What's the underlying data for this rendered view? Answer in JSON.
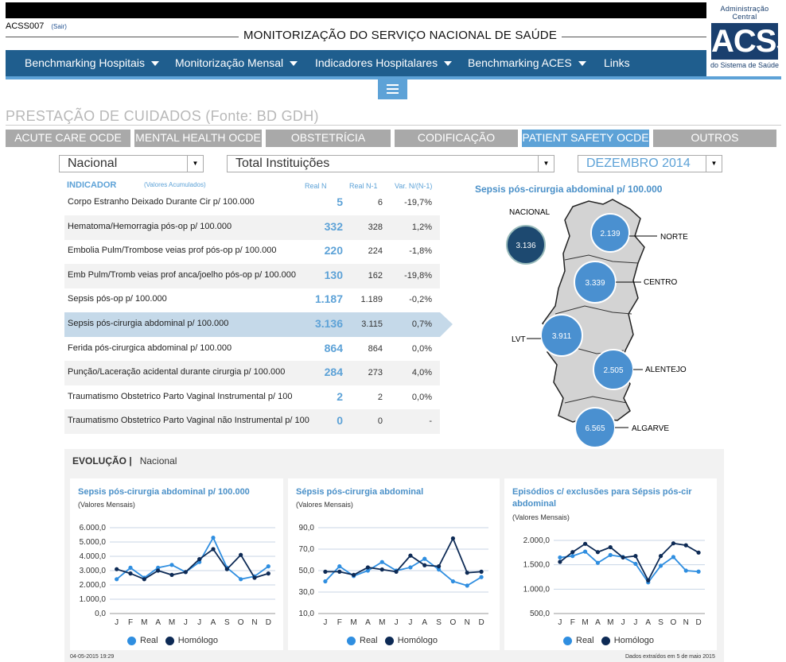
{
  "header": {
    "user_code": "ACSS007",
    "logout_label": "(Sair)",
    "app_title": "MONITORIZAÇÃO DO SERVIÇO NACIONAL DE SAÚDE",
    "logo": {
      "top": "Administração Central",
      "mark": "ACSS",
      "bottom": "do Sistema de Saúde"
    }
  },
  "nav": {
    "items": [
      {
        "label": "Benchmarking Hospitais",
        "dropdown": true
      },
      {
        "label": "Monitorização Mensal",
        "dropdown": true
      },
      {
        "label": "Indicadores Hospitalares",
        "dropdown": true
      },
      {
        "label": "Benchmarking ACES",
        "dropdown": true
      },
      {
        "label": "Links",
        "dropdown": false
      }
    ],
    "menu_icon": "hamburger-icon"
  },
  "section": {
    "title": "PRESTAÇÃO DE CUIDADOS (Fonte: BD GDH)",
    "tabs": [
      "ACUTE CARE OCDE",
      "MENTAL HEALTH OCDE",
      "OBSTETRÍCIA",
      "CODIFICAÇÃO",
      "PATIENT SAFETY OCDE",
      "OUTROS"
    ],
    "active_tab": "PATIENT SAFETY OCDE"
  },
  "filters": {
    "region": "Nacional",
    "institution": "Total Instituições",
    "period": "DEZEMBRO 2014"
  },
  "table": {
    "header": {
      "indicator": "INDICADOR",
      "note": "(Valores Acumulados)",
      "real_n": "Real N",
      "real_n1": "Real N-1",
      "var": "Var. N/(N-1)"
    },
    "rows": [
      {
        "name": "Corpo Estranho Deixado Durante Cir p/ 100.000",
        "real_n": "5",
        "real_n1": "6",
        "var": "-19,7%"
      },
      {
        "name": "Hematoma/Hemorragia pós-op p/ 100.000",
        "real_n": "332",
        "real_n1": "328",
        "var": "1,2%"
      },
      {
        "name": "Embolia Pulm/Trombose veias prof pós-op p/ 100.000",
        "real_n": "220",
        "real_n1": "224",
        "var": "-1,8%"
      },
      {
        "name": "Emb Pulm/Tromb veias prof anca/joelho pós-op p/ 100.000",
        "real_n": "130",
        "real_n1": "162",
        "var": "-19,8%"
      },
      {
        "name": "Sepsis pós-op p/ 100.000",
        "real_n": "1.187",
        "real_n1": "1.189",
        "var": "-0,2%"
      },
      {
        "name": "Sepsis pós-cirurgia abdominal p/ 100.000",
        "real_n": "3.136",
        "real_n1": "3.115",
        "var": "0,7%"
      },
      {
        "name": "Ferida pós-cirurgica abdominal p/ 100.000",
        "real_n": "864",
        "real_n1": "864",
        "var": "0,0%"
      },
      {
        "name": "Punção/Laceração acidental durante cirurgia p/ 100.000",
        "real_n": "284",
        "real_n1": "273",
        "var": "4,0%"
      },
      {
        "name": "Traumatismo Obstetrico Parto Vaginal Instrumental p/ 100",
        "real_n": "2",
        "real_n1": "2",
        "var": "0,0%"
      },
      {
        "name": "Traumatismo Obstetrico Parto Vaginal não Instrumental p/ 100",
        "real_n": "0",
        "real_n1": "0",
        "var": "-"
      }
    ],
    "selected_index": 5
  },
  "map": {
    "title": "Sepsis pós-cirurgia abdominal p/ 100.000",
    "national": {
      "label": "NACIONAL",
      "value": "3.136"
    },
    "regions": [
      {
        "name": "NORTE",
        "value": "2.139"
      },
      {
        "name": "CENTRO",
        "value": "3.339"
      },
      {
        "name": "LVT",
        "value": "3.911"
      },
      {
        "name": "ALENTEJO",
        "value": "2.505"
      },
      {
        "name": "ALGARVE",
        "value": "6.565"
      }
    ]
  },
  "evolution": {
    "title": "EVOLUÇÃO |",
    "scope": "Nacional",
    "legend": {
      "real": "Real",
      "homologo": "Homólogo"
    },
    "colors": {
      "real": "#2f8ee0",
      "homologo": "#0d2a55"
    },
    "footer_left": "04-05-2015 19:29",
    "footer_right": "Dados extraídos em 5 de maio 2015"
  },
  "chart_data": [
    {
      "type": "line",
      "title": "Sepsis pós-cirurgia abdominal p/ 100.000",
      "subtitle": "(Valores Mensais)",
      "categories": [
        "J",
        "F",
        "M",
        "A",
        "M",
        "J",
        "J",
        "A",
        "S",
        "O",
        "N",
        "D"
      ],
      "yticks": [
        "6.000,0",
        "5.000,0",
        "4.000,0",
        "3.000,0",
        "2.000,0",
        "1.000,0",
        "0,0"
      ],
      "ylim": [
        0,
        6000
      ],
      "series": [
        {
          "name": "Real",
          "values": [
            2400,
            3200,
            2500,
            3200,
            3400,
            2900,
            3600,
            5300,
            3200,
            2400,
            2600,
            3300
          ]
        },
        {
          "name": "Homólogo",
          "values": [
            3100,
            2800,
            2400,
            3000,
            2700,
            2900,
            3800,
            4500,
            3100,
            4100,
            2500,
            2800
          ]
        }
      ]
    },
    {
      "type": "line",
      "title": "Sépsis pós-cirurgia abdominal",
      "subtitle": "(Valores Mensais)",
      "categories": [
        "J",
        "F",
        "M",
        "A",
        "M",
        "J",
        "J",
        "A",
        "S",
        "O",
        "N",
        "D"
      ],
      "yticks": [
        "90,0",
        "70,0",
        "50,0",
        "30,0",
        "10,0"
      ],
      "ylim": [
        10,
        90
      ],
      "series": [
        {
          "name": "Real",
          "values": [
            40,
            54,
            45,
            50,
            58,
            50,
            53,
            61,
            51,
            40,
            36,
            44
          ]
        },
        {
          "name": "Homólogo",
          "values": [
            49,
            49,
            46,
            53,
            51,
            49,
            64,
            55,
            54,
            80,
            48,
            49
          ]
        }
      ]
    },
    {
      "type": "line",
      "title": "Episódios c/ exclusões para Sépsis pós-cir abdominal",
      "subtitle": "(Valores Mensais)",
      "categories": [
        "J",
        "F",
        "M",
        "A",
        "M",
        "J",
        "J",
        "A",
        "S",
        "O",
        "N",
        "D"
      ],
      "yticks": [
        "2.000,0",
        "1.500,0",
        "1.000,0",
        "500,0"
      ],
      "ylim": [
        500,
        2000
      ],
      "series": [
        {
          "name": "Real",
          "values": [
            1650,
            1680,
            1770,
            1540,
            1700,
            1660,
            1520,
            1140,
            1480,
            1660,
            1380,
            1360
          ]
        },
        {
          "name": "Homólogo",
          "values": [
            1560,
            1760,
            1930,
            1760,
            1860,
            1650,
            1680,
            1180,
            1680,
            1940,
            1900,
            1750
          ]
        }
      ]
    }
  ]
}
